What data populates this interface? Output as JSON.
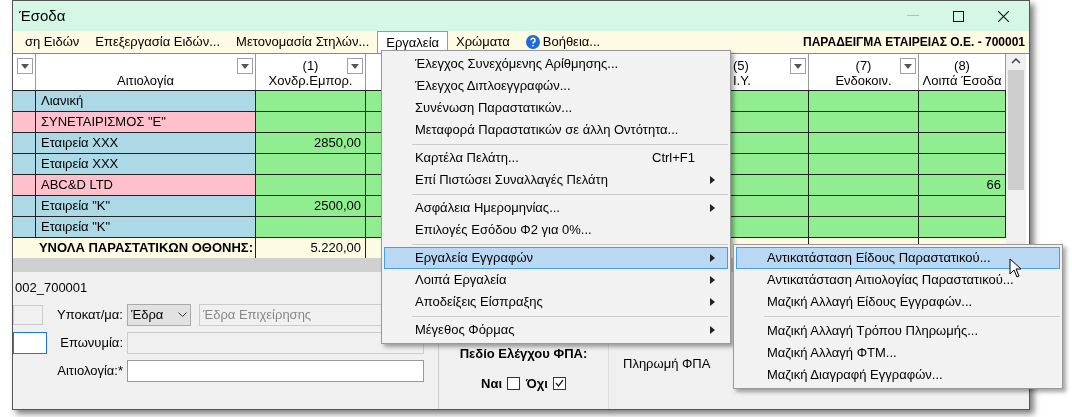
{
  "window": {
    "title": "Έσοδα"
  },
  "menu_bar": {
    "items": [
      {
        "label": "ση Ειδών",
        "selected": false,
        "kind": "text"
      },
      {
        "label": "Επεξεργασία Ειδών...",
        "selected": false,
        "kind": "text"
      },
      {
        "label": "Μετονομασία Στηλών...",
        "selected": false,
        "kind": "text"
      },
      {
        "label": "Εργαλεία",
        "selected": true,
        "kind": "text"
      },
      {
        "label": "Χρώματα",
        "selected": false,
        "kind": "text"
      },
      {
        "label": "Βοήθεια...",
        "selected": false,
        "kind": "help"
      }
    ],
    "company": "ΠΑΡΑΔΕΙΓΜΑ ΕΤΑΙΡΕΙΑΣ Ο.Ε. - 700001"
  },
  "table": {
    "columns": [
      {
        "filter": true
      },
      {
        "header": "Αιτιολογία",
        "filter": true
      },
      {
        "number": "(1)",
        "header": "Χονδρ.Εμπορ.",
        "filter": true
      },
      {},
      {
        "number": "(5)",
        "header": "Ι.Υ.",
        "filter": true
      },
      {
        "number": "(7)",
        "header": "Ενδοκοιν.",
        "filter": true
      },
      {
        "number": "(8)",
        "header": "Λοιπά Έσοδα",
        "filter": false
      }
    ],
    "rows": [
      {
        "label": "Λιανική",
        "color": "#add8e6"
      },
      {
        "label": "ΣΥΝΕΤΑΙΡΙΣΜΟΣ \"Ε\"",
        "color": "#ffc0cb"
      },
      {
        "label": "Εταιρεία XXX",
        "color": "#add8e6",
        "col1": "2850,00"
      },
      {
        "label": "Εταιρεία XXX",
        "color": "#add8e6"
      },
      {
        "label": "ABC&D LTD",
        "color": "#ffc0cb",
        "col8": "66"
      },
      {
        "label": "Εταιρεία \"Κ\"",
        "color": "#add8e6",
        "col1": "2500,00"
      },
      {
        "label": "Εταιρεία \"Κ\"",
        "color": "#add8e6"
      }
    ],
    "totals": {
      "label": "ΥΝΟΛΑ ΠΑΡΑΣΤΑΤΙΚΩΝ ΟΘΟΝΗΣ:",
      "col1": "5.220,00"
    }
  },
  "form": {
    "group": "002_700001",
    "branch_label": "Υποκατ/μα:",
    "branch_select": "Έδρα",
    "branch_name": "Έδρα Επιχείρησης",
    "name_label": "Επωνυμία:",
    "reason_label": "Αιτιολογία:*",
    "vat_check": {
      "title": "Πεδίο Ελέγχου ΦΠΑ:",
      "options": [
        {
          "label": "Ναι",
          "checked": false
        },
        {
          "label": "Όχι",
          "checked": true
        }
      ]
    },
    "vat_payment": "Πληρωμή ΦΠΑ"
  },
  "tools_menu": {
    "items": [
      {
        "kind": "item",
        "label": "Έλεγχος Συνεχόμενης Αρίθμησης...",
        "submenu": false,
        "selected": false
      },
      {
        "kind": "item",
        "label": "Έλεγχος Διπλοεγγραφών...",
        "submenu": false,
        "selected": false
      },
      {
        "kind": "item",
        "label": "Συνένωση Παραστατικών...",
        "submenu": false,
        "selected": false
      },
      {
        "kind": "item",
        "label": "Μεταφορά Παραστατικών σε άλλη Οντότητα...",
        "submenu": false,
        "selected": false
      },
      {
        "kind": "separator"
      },
      {
        "kind": "item",
        "label": "Καρτέλα Πελάτη...",
        "shortcut": "Ctrl+F1",
        "submenu": false,
        "selected": false
      },
      {
        "kind": "item",
        "label": "Επί Πιστώσει Συναλλαγές Πελάτη",
        "submenu": true,
        "selected": false
      },
      {
        "kind": "separator"
      },
      {
        "kind": "item",
        "label": "Ασφάλεια Ημερομηνίας...",
        "submenu": true,
        "selected": false
      },
      {
        "kind": "item",
        "label": "Επιλογές Εσόδου Φ2 για 0%...",
        "submenu": false,
        "selected": false
      },
      {
        "kind": "separator"
      },
      {
        "kind": "item",
        "label": "Εργαλεία Εγγραφών",
        "submenu": true,
        "selected": true
      },
      {
        "kind": "item",
        "label": "Λοιπά Εργαλεία",
        "submenu": true,
        "selected": false
      },
      {
        "kind": "item",
        "label": "Αποδείξεις Είσπραξης",
        "submenu": true,
        "selected": false
      },
      {
        "kind": "separator"
      },
      {
        "kind": "item",
        "label": "Μέγεθος Φόρμας",
        "submenu": true,
        "selected": false
      }
    ]
  },
  "records_submenu": {
    "items": [
      {
        "kind": "item",
        "label": "Αντικατάσταση Είδους Παραστατικού...",
        "selected": true
      },
      {
        "kind": "item",
        "label": "Αντικατάσταση Αιτιολογίας Παραστατικού...",
        "selected": false
      },
      {
        "kind": "item",
        "label": "Μαζική Αλλαγή Είδους Εγγραφών...",
        "selected": false
      },
      {
        "kind": "separator"
      },
      {
        "kind": "item",
        "label": "Μαζική Αλλαγή Τρόπου Πληρωμής...",
        "selected": false
      },
      {
        "kind": "item",
        "label": "Μαζική Αλλαγή ΦΤΜ...",
        "selected": false
      },
      {
        "kind": "item",
        "label": "Μαζική Διαγραφή Εγγραφών...",
        "selected": false
      }
    ]
  }
}
